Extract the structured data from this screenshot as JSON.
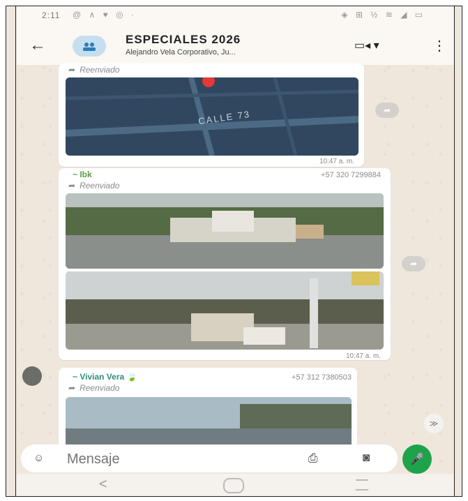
{
  "status": {
    "time": "2:11",
    "left_icons": "@ ∧ ♥ ◎ ·",
    "right_icons": "◈ ⊞ ½ ≋ ◢ ▭"
  },
  "header": {
    "title": "ESPECIALES 2026",
    "subtitle": "Alejandro Vela Corporativo, Ju...",
    "back_icon": "back-arrow-icon",
    "video_icon": "video-call-icon",
    "menu_icon": "more-vert-icon"
  },
  "messages": [
    {
      "forwarded_label": "Reenviado",
      "image": "map",
      "map_label": "CALLE 73",
      "time": "10:47 a. m."
    },
    {
      "sender": "~ Ibk",
      "phone": "+57 320 7299884",
      "forwarded_label": "Reenviado",
      "image": "street-photo",
      "time": "10:47 a. m."
    },
    {
      "sender": "~ Vivian Vera",
      "sender_emoji": "🍃",
      "phone": "+57 312 7380503",
      "forwarded_label": "Reenviado",
      "image": "road-photo"
    }
  ],
  "composer": {
    "placeholder": "Mensaje",
    "emoji_icon": "sticker-icon",
    "attach_icon": "attach-icon",
    "camera_icon": "camera-icon",
    "mic_icon": "mic-icon"
  },
  "colors": {
    "accent": "#1fa34a",
    "chat_bg": "#efe7dc",
    "sender_green": "#5a9d44",
    "sender_teal": "#2c8f7d"
  }
}
